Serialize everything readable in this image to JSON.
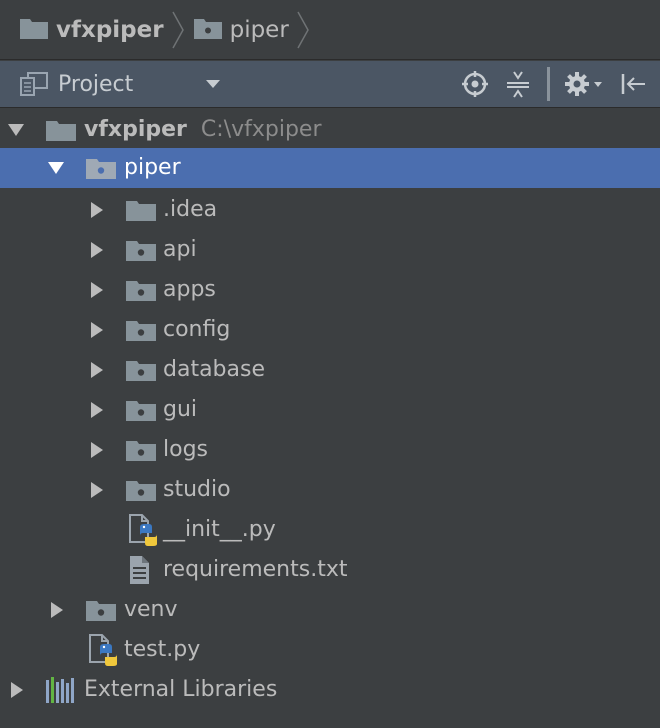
{
  "breadcrumb": {
    "items": [
      {
        "label": "vfxpiper"
      },
      {
        "label": "piper"
      }
    ]
  },
  "toolbar": {
    "title": "Project",
    "icons": [
      "project-view-icon",
      "dropdown-caret-icon",
      "locate-target-icon",
      "collapse-all-icon",
      "settings-gear-icon",
      "hide-panel-icon"
    ]
  },
  "tree": {
    "root": {
      "label": "vfxpiper",
      "path": "C:\\vfxpiper"
    },
    "piper": {
      "label": "piper"
    },
    "children": [
      {
        "label": ".idea"
      },
      {
        "label": "api"
      },
      {
        "label": "apps"
      },
      {
        "label": "config"
      },
      {
        "label": "database"
      },
      {
        "label": "gui"
      },
      {
        "label": "logs"
      },
      {
        "label": "studio"
      }
    ],
    "files": [
      {
        "label": "__init__.py"
      },
      {
        "label": "requirements.txt"
      }
    ],
    "venv": {
      "label": "venv"
    },
    "test": {
      "label": "test.py"
    },
    "external": {
      "label": "External Libraries"
    }
  },
  "colors": {
    "background": "#3c3f41",
    "toolbar": "#4b5664",
    "selection": "#4b6eaf",
    "folder": "#87939a",
    "text": "#bbbbbb",
    "path_text": "#8c8c8c"
  }
}
